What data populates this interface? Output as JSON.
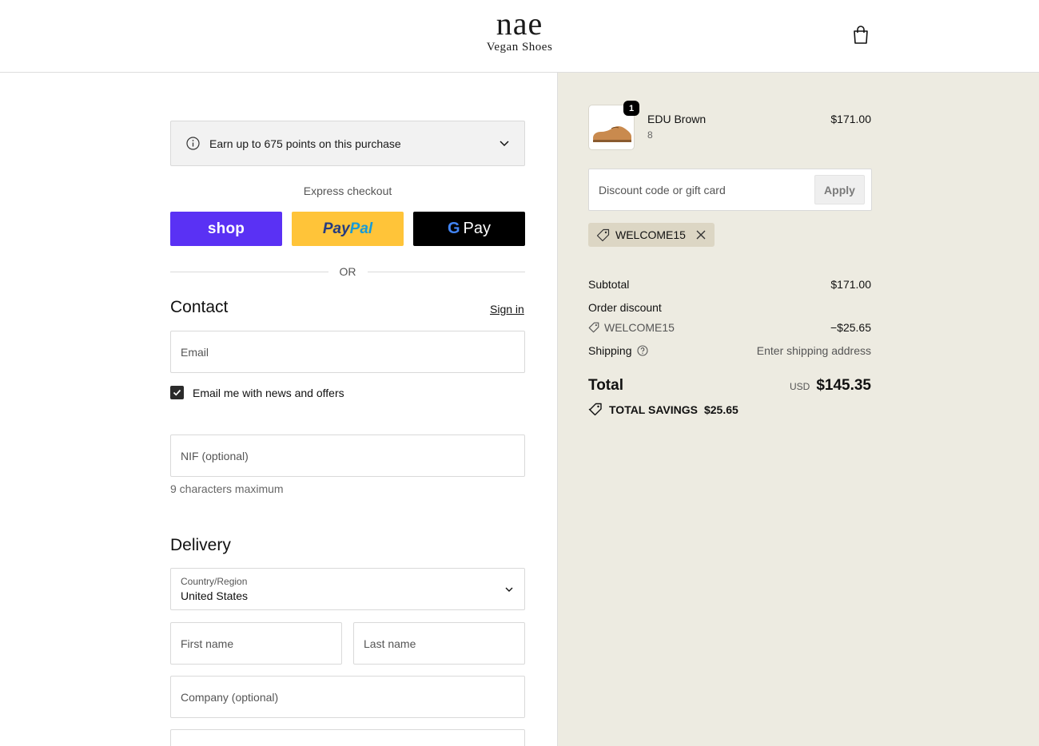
{
  "header": {
    "logo_main": "nae",
    "logo_sub": "Vegan Shoes",
    "cart_icon": "shopping-bag-icon"
  },
  "checkout": {
    "points_banner": "Earn up to 675 points on this purchase",
    "express_label": "Express checkout",
    "shop_pay_label": "shop",
    "paypal_label_1": "Pay",
    "paypal_label_2": "Pal",
    "gpay_label_g": "G",
    "gpay_label": "Pay",
    "or_label": "OR",
    "contact": {
      "title": "Contact",
      "sign_in": "Sign in",
      "email_placeholder": "Email",
      "newsletter_label": "Email me with news and offers",
      "newsletter_checked": true,
      "nif_placeholder": "NIF (optional)",
      "nif_hint": "9 characters maximum"
    },
    "delivery": {
      "title": "Delivery",
      "country_label": "Country/Region",
      "country_value": "United States",
      "first_name_placeholder": "First name",
      "last_name_placeholder": "Last name",
      "company_placeholder": "Company (optional)"
    }
  },
  "summary": {
    "product": {
      "name": "EDU Brown",
      "variant": "8",
      "price": "$171.00",
      "quantity": "1"
    },
    "discount_placeholder": "Discount code or gift card",
    "apply_label": "Apply",
    "applied_code": "WELCOME15",
    "subtotal_label": "Subtotal",
    "subtotal_value": "$171.00",
    "order_discount_label": "Order discount",
    "discount_code": "WELCOME15",
    "discount_value": "−$25.65",
    "shipping_label": "Shipping",
    "shipping_value": "Enter shipping address",
    "total_label": "Total",
    "total_currency": "USD",
    "total_value": "$145.35",
    "savings_label": "TOTAL SAVINGS",
    "savings_value": "$25.65"
  },
  "colors": {
    "shop_pay": "#5a31f4",
    "paypal": "#ffc439",
    "gpay": "#000000",
    "summary_bg": "#edebe1"
  }
}
